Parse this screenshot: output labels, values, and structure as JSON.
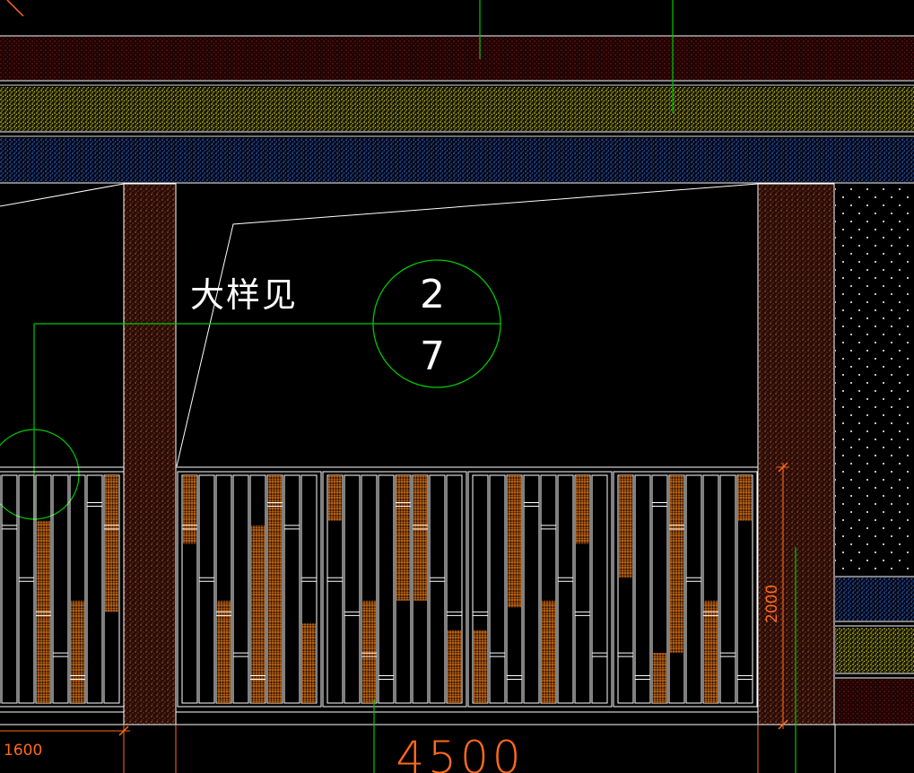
{
  "drawing": {
    "background": "#000000",
    "callout_text": "大样见",
    "detail_number": "2",
    "sheet_number": "7",
    "dim_total": "4500",
    "dim_left": "1600",
    "dim_height": "2000"
  },
  "colors": {
    "line_white": "#ffffff",
    "leader_green": "#00c800",
    "dimension": "#ff6a1a",
    "brick_fill": "#3a1008",
    "brick_dots": "#c06a40",
    "sand_fill": "#1a1a00",
    "sand_dots": "#e6e640",
    "water_fill": "#000a1a",
    "water_dots": "#4a7ae6",
    "panel_hatch": "#ff8a1a"
  }
}
